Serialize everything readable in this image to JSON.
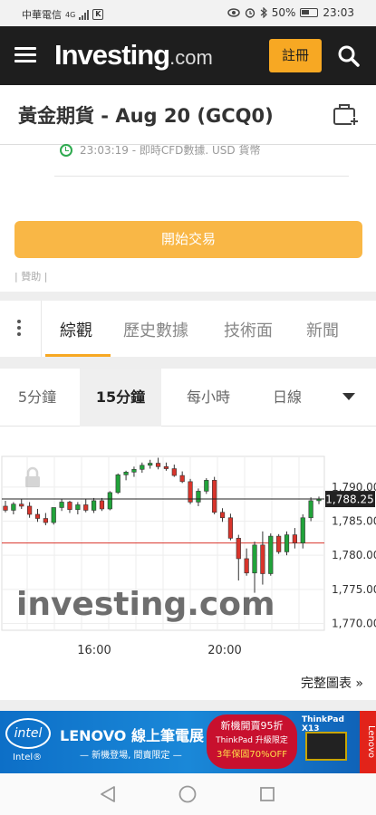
{
  "status_bar": {
    "carrier": "中華電信",
    "network": "4G",
    "battery": "50%",
    "time": "23:03"
  },
  "nav": {
    "logo_main": "Investing",
    "logo_suffix": ".com",
    "register_label": "註冊"
  },
  "instrument": {
    "title": "黃金期貨 - Aug 20 (GCQ0)",
    "time_info": "23:03:19 - 即時CFD數據. USD 貨幣"
  },
  "trade_button": "開始交易",
  "sponsor_label": "| 贊助 |",
  "tabs": [
    {
      "label": "綜觀",
      "active": true
    },
    {
      "label": "歷史數據",
      "active": false
    },
    {
      "label": "技術面",
      "active": false
    },
    {
      "label": "新聞",
      "active": false
    }
  ],
  "intervals": [
    {
      "label": "5分鐘",
      "active": false
    },
    {
      "label": "15分鐘",
      "active": true
    },
    {
      "label": "每小時",
      "active": false
    },
    {
      "label": "日線",
      "active": false
    }
  ],
  "chart_data": {
    "type": "candlestick",
    "x_ticks": [
      "16:00",
      "20:00"
    ],
    "y_ticks": [
      "1,790.00",
      "1,785.00",
      "1,780.00",
      "1,775.00",
      "1,770.00"
    ],
    "ylim": [
      1769,
      1794.5
    ],
    "current_price": 1788.25,
    "current_price_label": "1,788.25",
    "reference_line": 1781.8,
    "watermark": "investing.com",
    "colors": {
      "up": "#21a33a",
      "down": "#d9342b",
      "current_line": "#222222",
      "reference_line": "#d9342b"
    },
    "candles": [
      {
        "o": 1787.2,
        "h": 1788.0,
        "l": 1786.3,
        "c": 1786.6
      },
      {
        "o": 1786.6,
        "h": 1787.8,
        "l": 1786.0,
        "c": 1787.5
      },
      {
        "o": 1787.5,
        "h": 1788.3,
        "l": 1786.8,
        "c": 1787.2
      },
      {
        "o": 1787.2,
        "h": 1787.8,
        "l": 1785.5,
        "c": 1786.0
      },
      {
        "o": 1786.0,
        "h": 1786.8,
        "l": 1784.9,
        "c": 1785.4
      },
      {
        "o": 1785.4,
        "h": 1786.2,
        "l": 1784.4,
        "c": 1784.8
      },
      {
        "o": 1784.8,
        "h": 1787.0,
        "l": 1784.5,
        "c": 1787.0
      },
      {
        "o": 1787.0,
        "h": 1788.2,
        "l": 1786.5,
        "c": 1787.8
      },
      {
        "o": 1787.8,
        "h": 1788.0,
        "l": 1786.2,
        "c": 1786.7
      },
      {
        "o": 1786.7,
        "h": 1787.8,
        "l": 1786.0,
        "c": 1787.4
      },
      {
        "o": 1787.4,
        "h": 1788.2,
        "l": 1786.3,
        "c": 1786.6
      },
      {
        "o": 1786.6,
        "h": 1788.4,
        "l": 1786.2,
        "c": 1788.0
      },
      {
        "o": 1788.0,
        "h": 1788.4,
        "l": 1786.5,
        "c": 1786.8
      },
      {
        "o": 1786.8,
        "h": 1789.4,
        "l": 1786.6,
        "c": 1789.2
      },
      {
        "o": 1789.2,
        "h": 1792.0,
        "l": 1789.0,
        "c": 1791.8
      },
      {
        "o": 1791.8,
        "h": 1792.4,
        "l": 1791.0,
        "c": 1792.2
      },
      {
        "o": 1792.2,
        "h": 1793.0,
        "l": 1791.5,
        "c": 1792.6
      },
      {
        "o": 1792.6,
        "h": 1793.6,
        "l": 1792.1,
        "c": 1793.2
      },
      {
        "o": 1793.2,
        "h": 1794.0,
        "l": 1792.7,
        "c": 1793.5
      },
      {
        "o": 1793.5,
        "h": 1794.3,
        "l": 1792.6,
        "c": 1793.0
      },
      {
        "o": 1793.0,
        "h": 1793.6,
        "l": 1792.4,
        "c": 1792.7
      },
      {
        "o": 1792.7,
        "h": 1793.3,
        "l": 1791.5,
        "c": 1791.7
      },
      {
        "o": 1791.7,
        "h": 1792.3,
        "l": 1790.6,
        "c": 1790.8
      },
      {
        "o": 1790.8,
        "h": 1791.2,
        "l": 1787.5,
        "c": 1787.8
      },
      {
        "o": 1787.8,
        "h": 1789.8,
        "l": 1787.2,
        "c": 1789.4
      },
      {
        "o": 1789.4,
        "h": 1791.3,
        "l": 1789.0,
        "c": 1791.0
      },
      {
        "o": 1791.0,
        "h": 1791.5,
        "l": 1786.0,
        "c": 1786.3
      },
      {
        "o": 1786.3,
        "h": 1786.9,
        "l": 1784.9,
        "c": 1785.5
      },
      {
        "o": 1785.5,
        "h": 1786.1,
        "l": 1782.2,
        "c": 1782.5
      },
      {
        "o": 1782.5,
        "h": 1783.0,
        "l": 1776.3,
        "c": 1779.5
      },
      {
        "o": 1779.5,
        "h": 1781.0,
        "l": 1777.0,
        "c": 1777.4
      },
      {
        "o": 1777.4,
        "h": 1782.0,
        "l": 1774.5,
        "c": 1781.5
      },
      {
        "o": 1781.5,
        "h": 1783.5,
        "l": 1775.7,
        "c": 1777.3
      },
      {
        "o": 1777.3,
        "h": 1783.2,
        "l": 1777.0,
        "c": 1782.8
      },
      {
        "o": 1782.8,
        "h": 1783.1,
        "l": 1780.2,
        "c": 1780.5
      },
      {
        "o": 1780.5,
        "h": 1783.5,
        "l": 1780.0,
        "c": 1783.0
      },
      {
        "o": 1783.0,
        "h": 1784.0,
        "l": 1781.0,
        "c": 1781.8
      },
      {
        "o": 1781.8,
        "h": 1786.0,
        "l": 1781.0,
        "c": 1785.5
      },
      {
        "o": 1785.5,
        "h": 1788.5,
        "l": 1785.0,
        "c": 1788.0
      },
      {
        "o": 1788.0,
        "h": 1788.6,
        "l": 1787.5,
        "c": 1788.25
      }
    ]
  },
  "full_chart_link": "完整圖表 »",
  "ad": {
    "intel": "intel",
    "intel_sub": "Intel®",
    "title": "LENOVO 線上筆電展",
    "subtitle": "— 新機登場, 間賣限定 —",
    "promo_line1": "新機開賣95折",
    "promo_line2": "ThinkPad 升級限定",
    "promo_line3": "3年保固70%OFF",
    "brand": "ThinkPad X13",
    "side_brand": "Lenovo"
  }
}
